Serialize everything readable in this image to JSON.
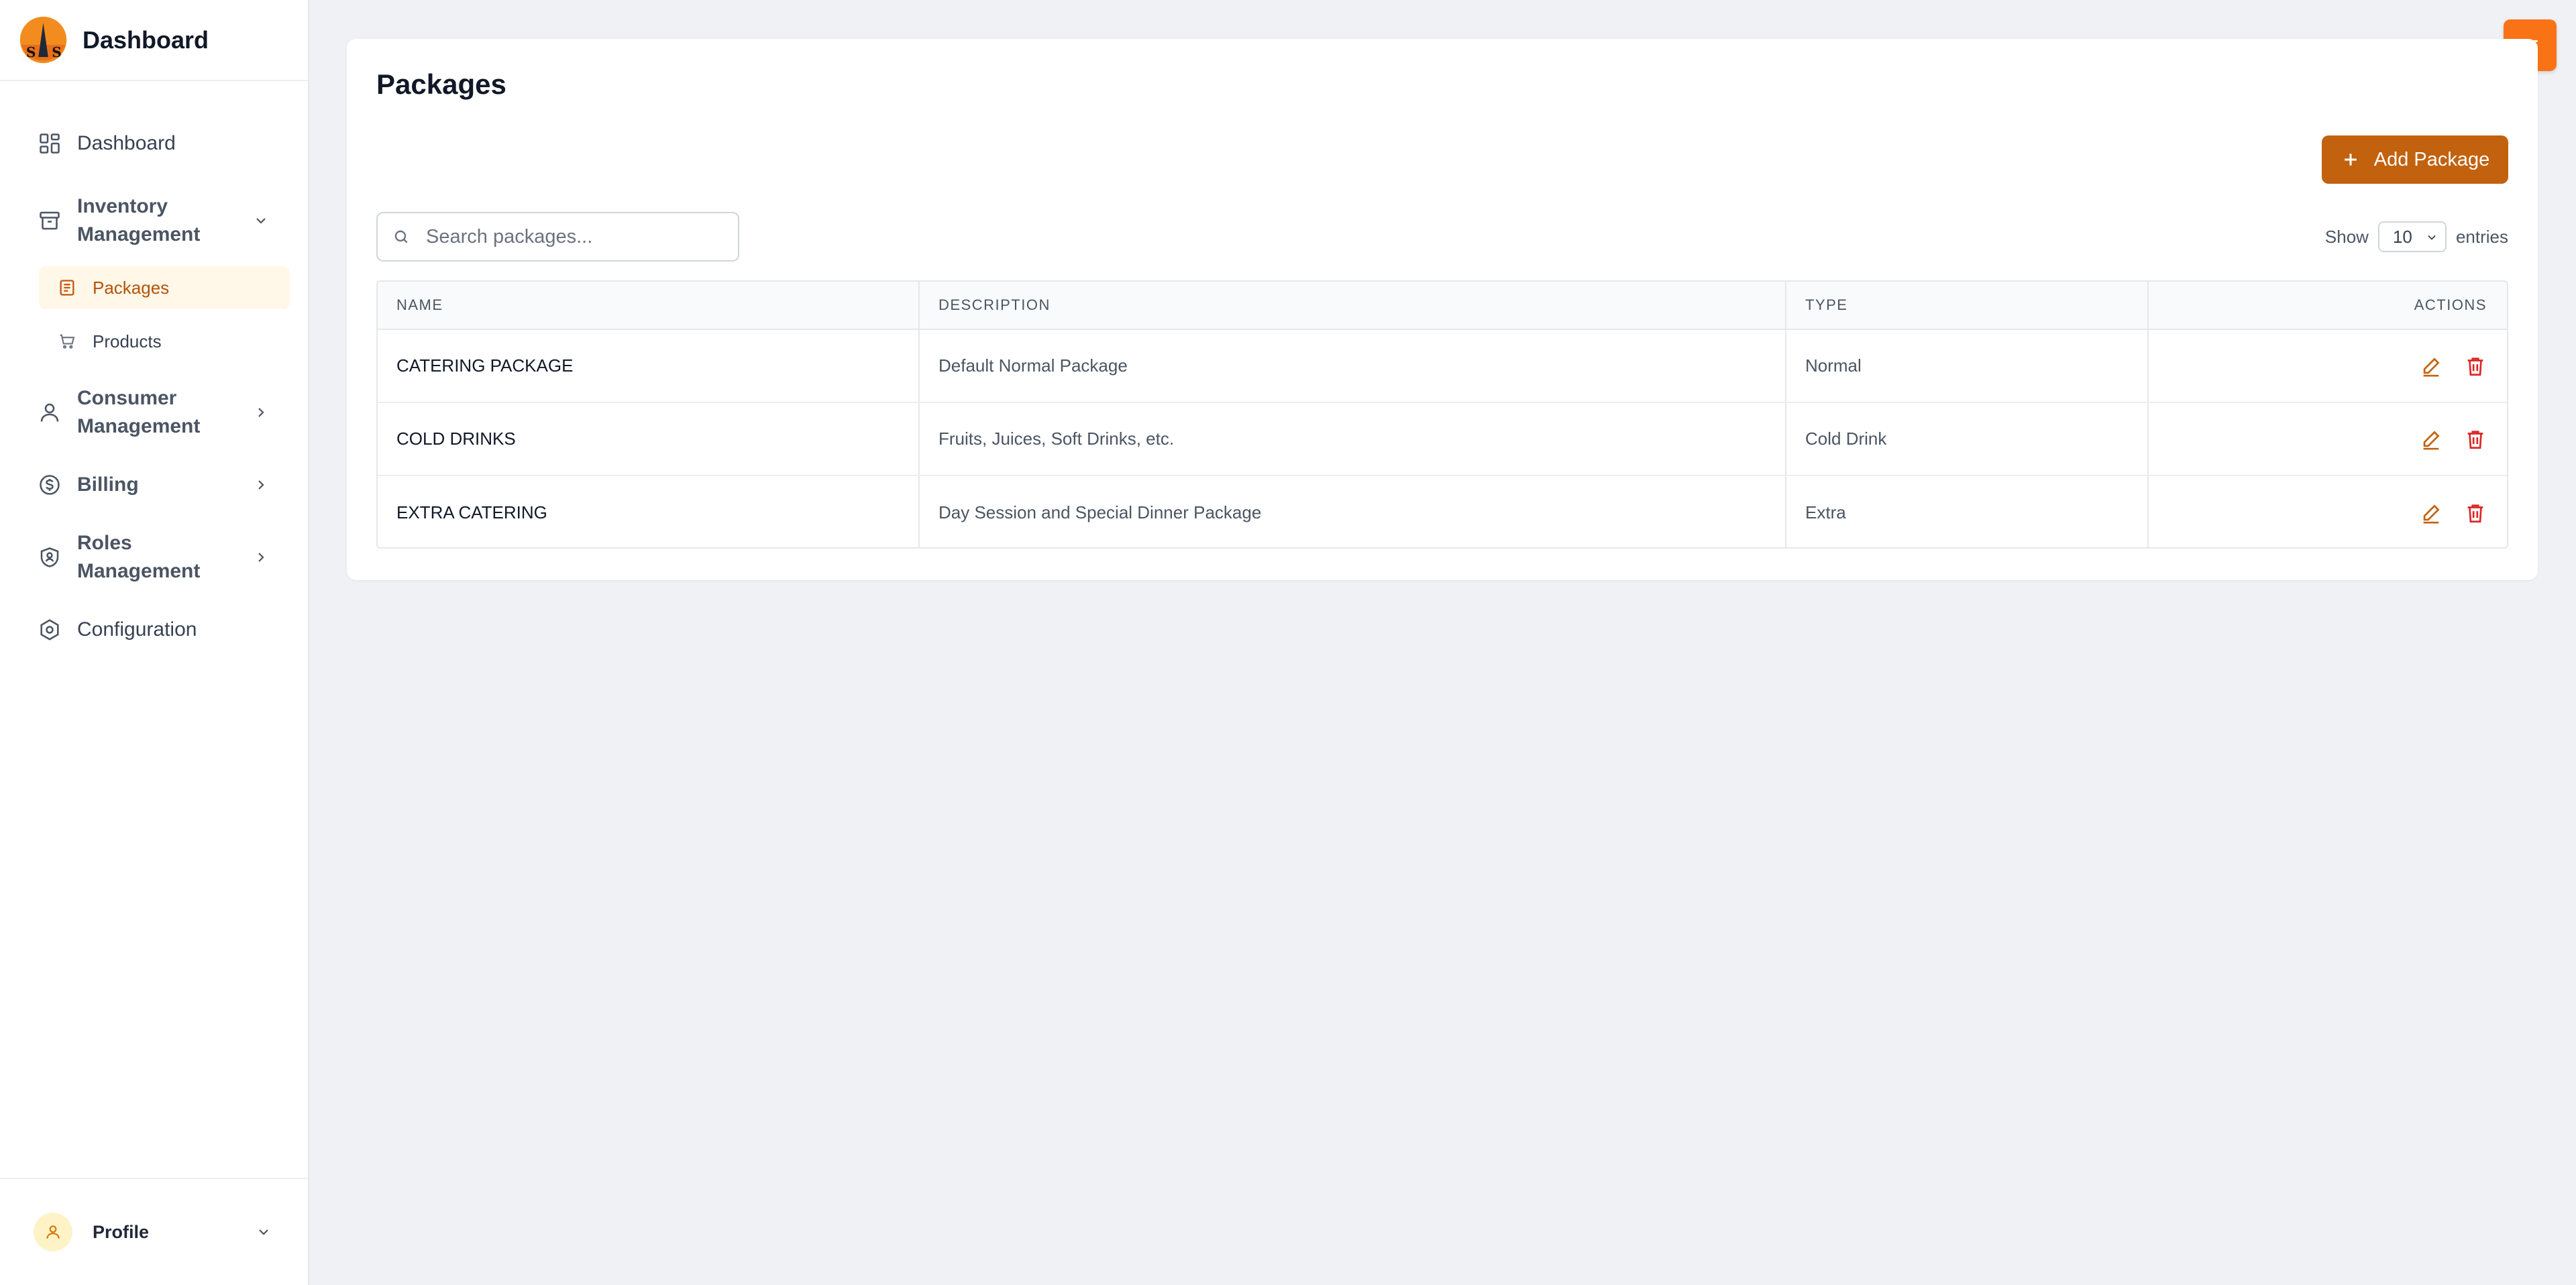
{
  "app": {
    "title": "Dashboard"
  },
  "sidebar": {
    "items": [
      {
        "label": "Dashboard",
        "icon": "grid-icon"
      },
      {
        "label": "Inventory Management",
        "icon": "archive-box-icon",
        "expanded": true,
        "children": [
          {
            "label": "Packages",
            "icon": "document-list-icon",
            "active": true
          },
          {
            "label": "Products",
            "icon": "cart-icon"
          }
        ]
      },
      {
        "label": "Consumer Management",
        "icon": "user-icon"
      },
      {
        "label": "Billing",
        "icon": "dollar-circle-icon"
      },
      {
        "label": "Roles Management",
        "icon": "shield-user-icon"
      },
      {
        "label": "Configuration",
        "icon": "hexagon-cog-icon"
      }
    ],
    "profile": {
      "label": "Profile"
    }
  },
  "page": {
    "title": "Packages",
    "add_button": "Add Package",
    "search_placeholder": "Search packages...",
    "show_label": "Show",
    "entries_value": "10",
    "entries_label": "entries"
  },
  "table": {
    "columns": [
      "NAME",
      "DESCRIPTION",
      "TYPE",
      "ACTIONS"
    ],
    "rows": [
      {
        "name": "CATERING PACKAGE",
        "description": "Default Normal Package",
        "type": "Normal"
      },
      {
        "name": "COLD DRINKS",
        "description": "Fruits, Juices, Soft Drinks, etc.",
        "type": "Cold Drink"
      },
      {
        "name": "EXTRA CATERING",
        "description": "Day Session and Special Dinner Package",
        "type": "Extra"
      }
    ]
  },
  "colors": {
    "accent": "#c2620f",
    "menu_button": "#f97316",
    "active_bg": "#fff7e8",
    "delete": "#dc2626",
    "background": "#f0f1f5"
  }
}
